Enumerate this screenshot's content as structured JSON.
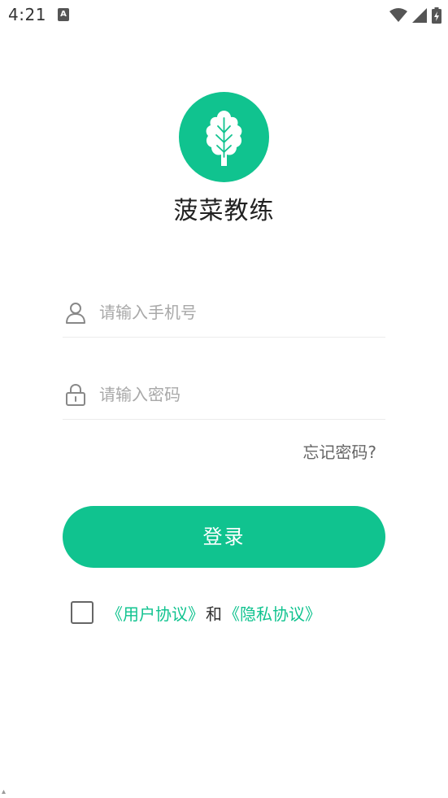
{
  "status_bar": {
    "time": "4:21",
    "notification_icon": "A"
  },
  "app": {
    "title": "菠菜教练",
    "brand_color": "#10c38f",
    "logo_icon": "spinach-leaf-icon"
  },
  "form": {
    "phone_placeholder": "请输入手机号",
    "phone_value": "",
    "password_placeholder": "请输入密码",
    "password_value": "",
    "forgot_label": "忘记密码?",
    "login_label": "登录"
  },
  "agreement": {
    "checked": false,
    "user_agreement": "《用户协议》",
    "and_text": "和",
    "privacy_policy": "《隐私协议》"
  }
}
